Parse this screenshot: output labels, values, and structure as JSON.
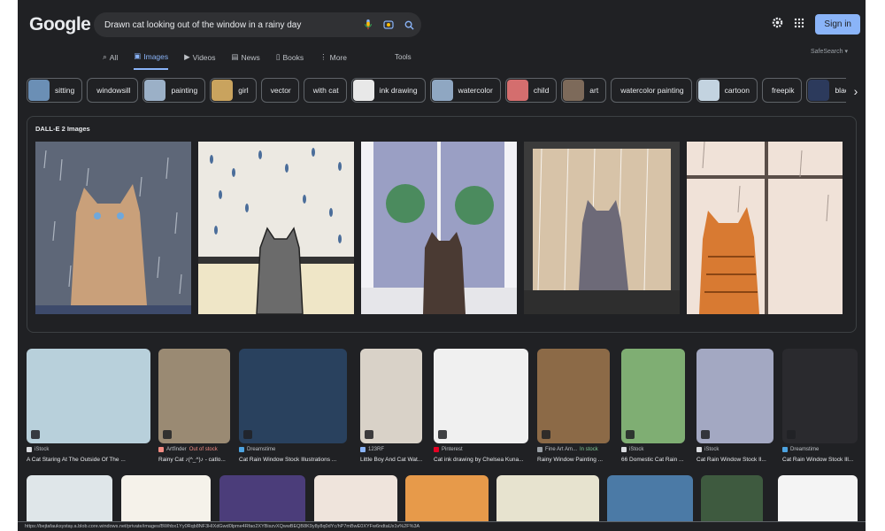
{
  "header": {
    "logo": "Google",
    "search_value": "Drawn cat looking out of the window in a rainy day",
    "sign_in": "Sign in"
  },
  "tabs": [
    {
      "label": "All",
      "icon": "search-icon"
    },
    {
      "label": "Images",
      "icon": "image-icon",
      "active": true
    },
    {
      "label": "Videos",
      "icon": "video-icon"
    },
    {
      "label": "News",
      "icon": "news-icon"
    },
    {
      "label": "Books",
      "icon": "book-icon"
    },
    {
      "label": "More",
      "icon": "more-icon"
    }
  ],
  "tools": "Tools",
  "safesearch": "SafeSearch",
  "chips": [
    {
      "label": "sitting",
      "thumb": "#6b8fb5"
    },
    {
      "label": "windowsill"
    },
    {
      "label": "painting",
      "thumb": "#9bb0c7"
    },
    {
      "label": "girl",
      "thumb": "#c9a35e"
    },
    {
      "label": "vector"
    },
    {
      "label": "with cat"
    },
    {
      "label": "ink drawing",
      "thumb": "#e8e8e8"
    },
    {
      "label": "watercolor",
      "thumb": "#8fa7c2"
    },
    {
      "label": "child",
      "thumb": "#d46e6e"
    },
    {
      "label": "art",
      "thumb": "#7d6a5a"
    },
    {
      "label": "watercolor painting"
    },
    {
      "label": "cartoon",
      "thumb": "#c3d3e0"
    },
    {
      "label": "freepik"
    },
    {
      "label": "black cat",
      "thumb": "#2c3a5c"
    }
  ],
  "dalle": {
    "title": "DALL-E 2 Images"
  },
  "results": [
    {
      "source": "iStock",
      "title": "A Cat Staring At The Outside Of The ...",
      "fav": "#dadce0"
    },
    {
      "source": "Artfinder",
      "status": "Out of stock",
      "status_type": "out",
      "title": "Rainy Cat ♪(^_^)♪ - catlo...",
      "fav": "#f28b82"
    },
    {
      "source": "Dreamstime",
      "title": "Cat Rain Window Stock Illustrations ...",
      "fav": "#4da3e0"
    },
    {
      "source": "123RF",
      "title": "Little Boy And Cat Wat...",
      "fav": "#8ab4f8"
    },
    {
      "source": "Pinterest",
      "title": "Cat ink drawing by Chelsea Kuna...",
      "fav": "#e60023"
    },
    {
      "source": "Fine Art Am...",
      "status": "In stock",
      "status_type": "in",
      "title": "Rainy Window Painting ...",
      "fav": "#9aa0a6"
    },
    {
      "source": "iStock",
      "title": "66 Domestic Cat Rain ...",
      "fav": "#dadce0"
    },
    {
      "source": "iStock",
      "title": "Cat Rain Window Stock Il...",
      "fav": "#dadce0"
    },
    {
      "source": "Dreamstime",
      "title": "Cat Rain Window Stock Ill...",
      "fav": "#4da3e0"
    }
  ],
  "status_url": "https://bejtafauksystay.a.blob.core.windows.net/private/images/BWhbx1Yy0Rqb8NF3HIXdGwd0lpme4Rfao2XYBiszvXQwwBEQB8K9y8y8q0dYc/hP7mBwE0XYFw6ndtaUx1v%2F%3A"
}
